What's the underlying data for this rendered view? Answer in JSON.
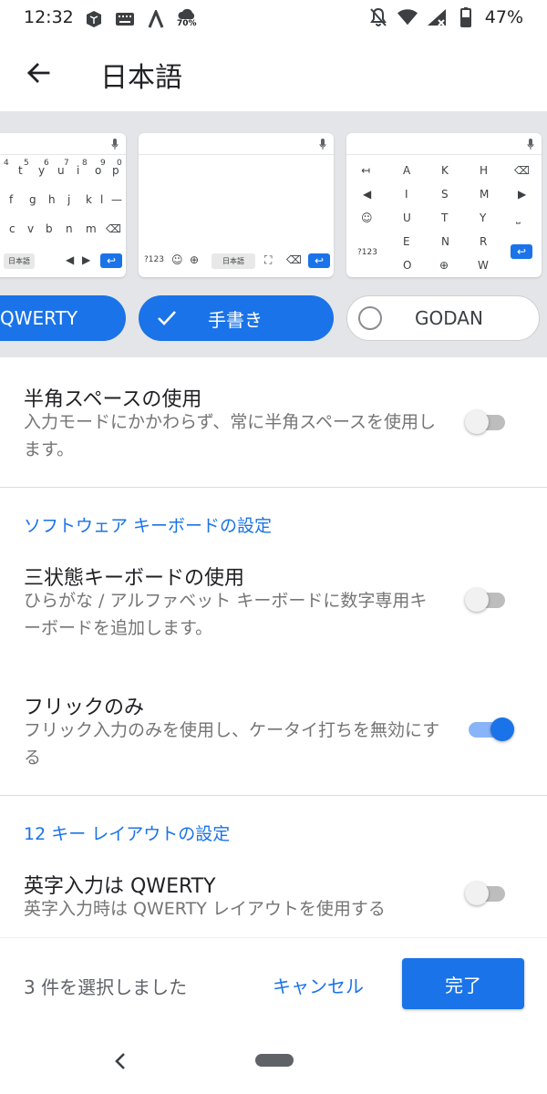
{
  "status_bar": {
    "time": "12:32",
    "weather_text": "70%",
    "battery": "47%",
    "left_icons": [
      "box-icon",
      "keyboard-icon",
      "app-a-icon",
      "weather-icon"
    ],
    "right_icons": [
      "mute-icon",
      "wifi-icon",
      "signal-icon",
      "battery-icon"
    ]
  },
  "app_bar": {
    "title": "日本語"
  },
  "keyboards": {
    "qwerty": {
      "label": "QWERTY",
      "selected": true,
      "rows": [
        [
          "t",
          "y",
          "u",
          "i",
          "o",
          "p"
        ],
        [
          "f",
          "g",
          "h",
          "j",
          "k",
          "l",
          "—"
        ],
        [
          "c",
          "v",
          "b",
          "n",
          "m",
          "⌫"
        ]
      ],
      "num_row": [
        "4",
        "5",
        "6",
        "7",
        "8",
        "9",
        "0"
      ],
      "lang_key": "日本語"
    },
    "handwriting": {
      "label": "手書き",
      "selected": true,
      "sym_key": "?123",
      "lang_key": "日本語"
    },
    "godan": {
      "label": "GODAN",
      "selected": false,
      "sym_key": "?123",
      "vowels": [
        "A",
        "I",
        "U",
        "E",
        "O"
      ],
      "consonants_mid": [
        "K",
        "S",
        "T",
        "N",
        "⊕"
      ],
      "consonants_right": [
        "H",
        "M",
        "Y",
        "R",
        "W"
      ]
    }
  },
  "settings": {
    "half_space": {
      "title": "半角スペースの使用",
      "summary": "入力モードにかかわらず、常に半角スペースを使用します。",
      "on": false
    },
    "section_software": "ソフトウェア キーボードの設定",
    "tri_state": {
      "title": "三状態キーボードの使用",
      "summary": "ひらがな / アルファベット キーボードに数字専用キーボードを追加します。",
      "on": false
    },
    "flick_only": {
      "title": "フリックのみ",
      "summary": "フリック入力のみを使用し、ケータイ打ちを無効にする",
      "on": true
    },
    "section_12key": "12 キー レイアウトの設定",
    "alpha_qwerty": {
      "title": "英字入力は QWERTY",
      "summary": "英字入力時は QWERTY レイアウトを使用する",
      "on": false
    }
  },
  "action_bar": {
    "selected_count": "3 件を選択しました",
    "cancel": "キャンセル",
    "done": "完了"
  },
  "colors": {
    "accent": "#1a73e8",
    "strip_bg": "#e4e5e8"
  }
}
